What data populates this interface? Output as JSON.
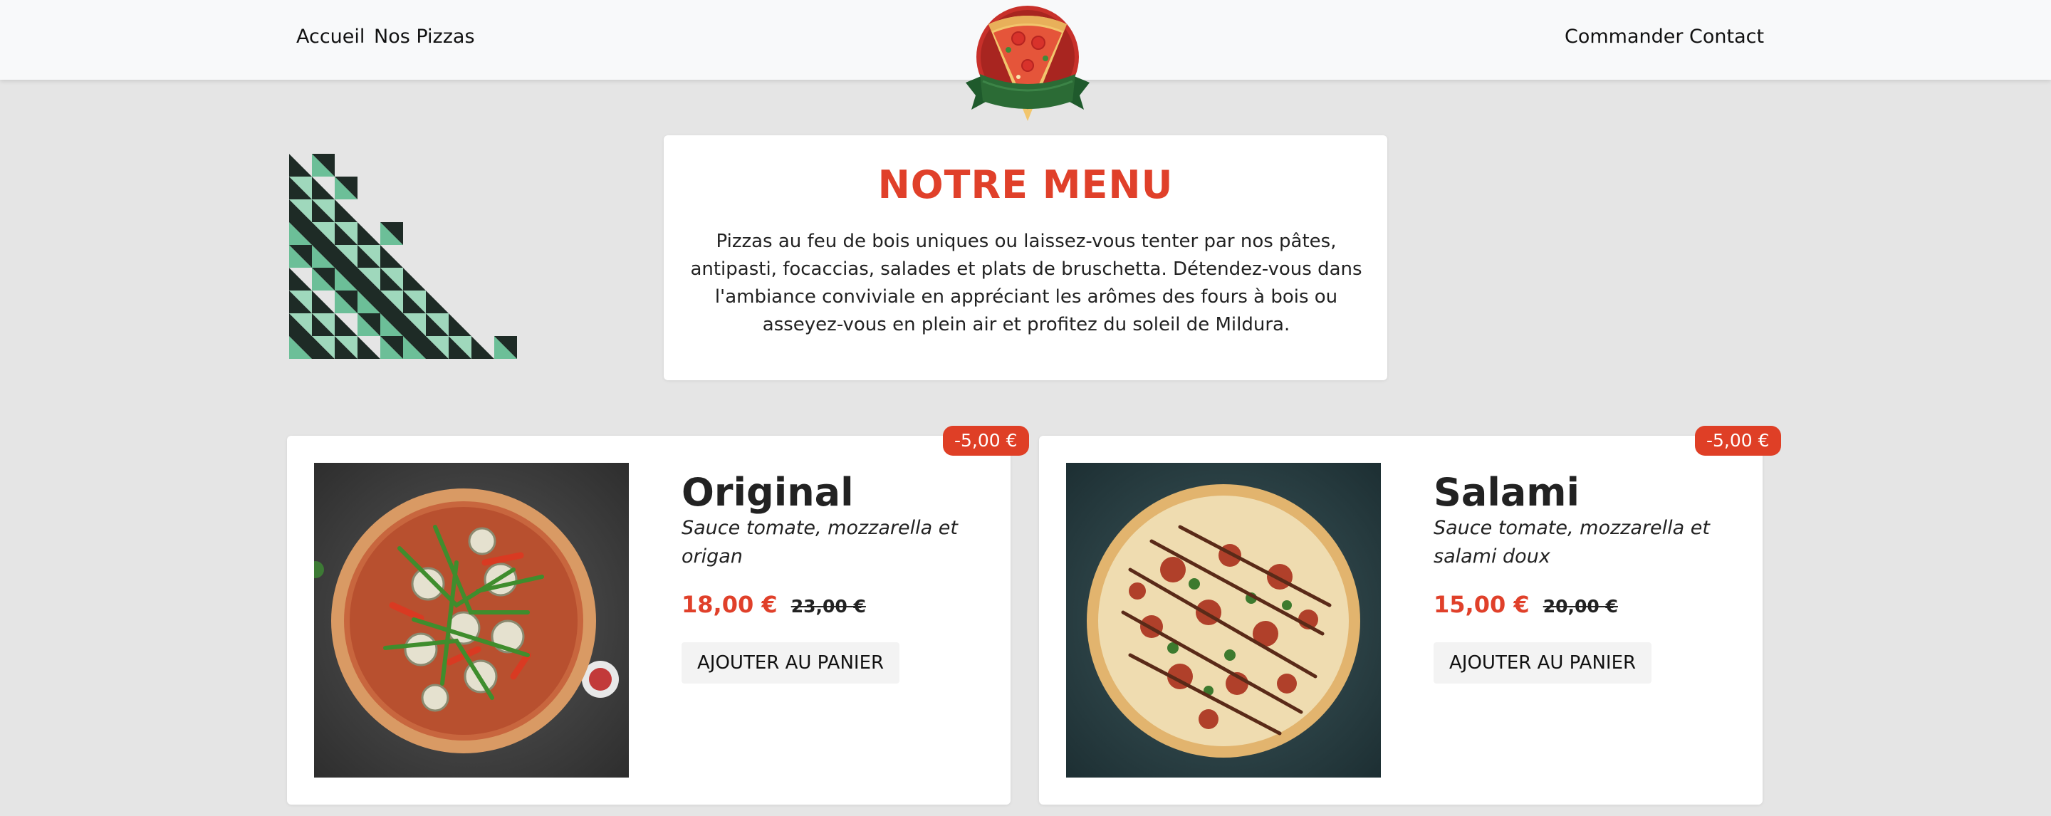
{
  "nav": {
    "left": [
      "Accueil",
      "Nos Pizzas"
    ],
    "right": [
      "Commander",
      "Contact"
    ]
  },
  "logo": {
    "icon": "pizza-logo-icon"
  },
  "intro": {
    "title": "NOTRE MENU",
    "text": "Pizzas au feu de bois uniques ou laissez-vous tenter par nos pâtes, antipasti, focaccias, salades et plats de bruschetta. Détendez-vous dans l'ambiance conviviale en appréciant les arômes des fours à bois ou asseyez-vous en plein air et profitez du soleil de Mildura."
  },
  "products": [
    {
      "name": "Original",
      "description": "Sauce tomate, mozzarella et origan",
      "price": "18,00 €",
      "old_price": "23,00 €",
      "discount": "-5,00 €",
      "button": "AJOUTER AU PANIER"
    },
    {
      "name": "Salami",
      "description": "Sauce tomate, mozzarella et salami doux",
      "price": "15,00 €",
      "old_price": "20,00 €",
      "discount": "-5,00 €",
      "button": "AJOUTER AU PANIER"
    }
  ],
  "colors": {
    "accent": "#e0402a",
    "background": "#e5e5e5",
    "navbar": "#f8f9fa",
    "triangle_dark": "#1e2b26",
    "triangle_green": "#6cbf98",
    "logo_green": "#2b6b35"
  }
}
